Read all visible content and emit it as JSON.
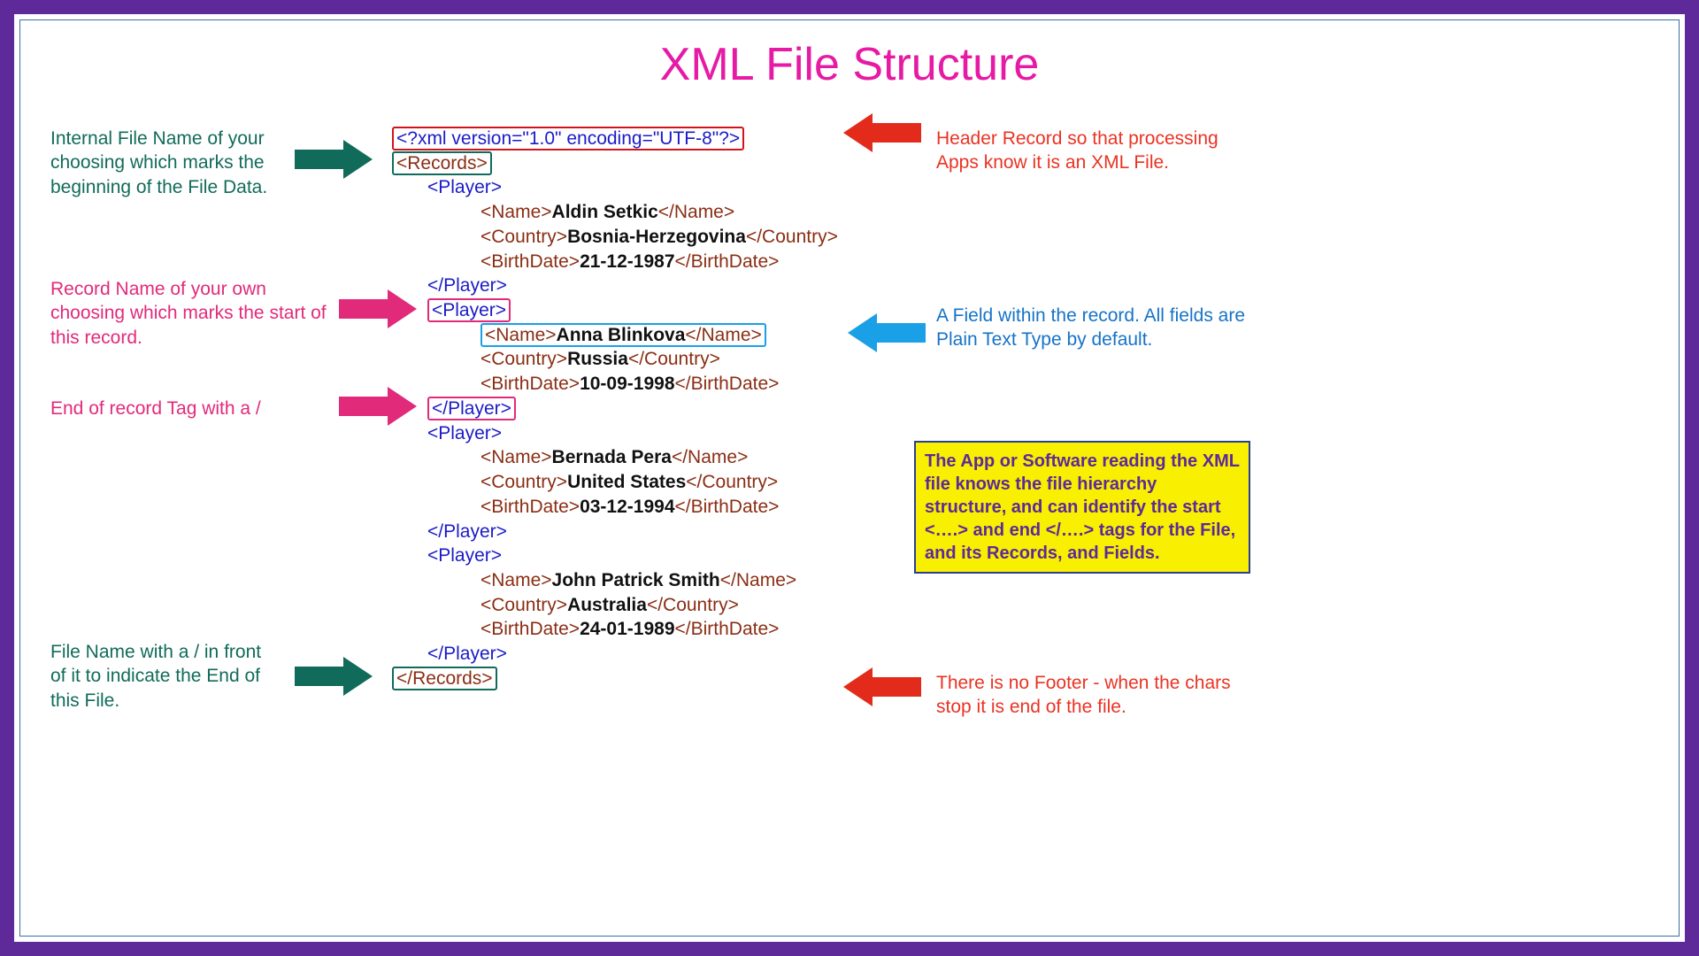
{
  "title": "XML File Structure",
  "xml": {
    "decl_open": "<?xml version=\"1.0\" encoding=\"UTF-8\"?>",
    "records_open": "<Records>",
    "records_close": "</Records>",
    "player_open": "<Player>",
    "player_close": "</Player>",
    "name_open": "<Name>",
    "name_close": "</Name>",
    "country_open": "<Country>",
    "country_close": "</Country>",
    "birth_open": "<BirthDate>",
    "birth_close": "</BirthDate>",
    "players": [
      {
        "name": "Aldin Setkic",
        "country": "Bosnia-Herzegovina",
        "birth": "21-12-1987"
      },
      {
        "name": "Anna Blinkova",
        "country": "Russia",
        "birth": "10-09-1998"
      },
      {
        "name": "Bernada Pera",
        "country": "United States",
        "birth": "03-12-1994"
      },
      {
        "name": "John Patrick Smith",
        "country": "Australia",
        "birth": "24-01-1989"
      }
    ]
  },
  "annotations": {
    "internal_file_name": "Internal File Name of your choosing which marks the beginning of the File Data.",
    "header_record": "Header Record so that processing Apps know it is an XML File.",
    "record_name": "Record Name of your own choosing which marks the start of this record.",
    "field_note": "A Field within the record. All fields are Plain Text Type by default.",
    "end_record": "End of record Tag with a /",
    "file_close": "File Name with a / in front of it to indicate the End of this File.",
    "no_footer": "There is no Footer - when the chars stop it is end of the file.",
    "infobox": "The App or Software reading the XML file knows the file hierarchy structure, and can identify the start <….> and end </….> tags for the File, and its Records, and Fields."
  },
  "colors": {
    "purple": "#5e2999",
    "magenta": "#e61aa4",
    "teal": "#116b5a",
    "red": "#d3131a",
    "pink": "#e22a7b",
    "cyan": "#1aa0e6",
    "blue": "#1673c7",
    "yellow": "#f8f000"
  }
}
